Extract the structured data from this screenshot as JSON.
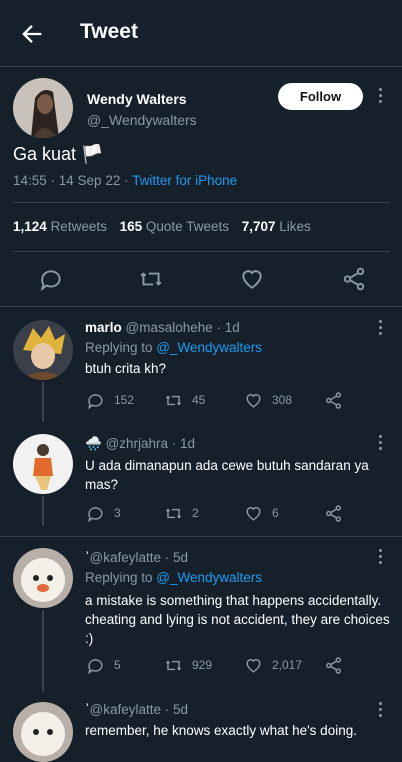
{
  "header": {
    "title": "Tweet",
    "back_icon": "back-arrow-icon"
  },
  "tweet": {
    "author_name": "Wendy Walters",
    "author_handle": "@_Wendywalters",
    "follow_label": "Follow",
    "text": "Ga kuat 🏳️",
    "time": "14:55 · 14 Sep 22 · ",
    "source": "Twitter for iPhone",
    "retweets_count": "1,124",
    "retweets_label": "Retweets",
    "quotes_count": "165",
    "quotes_label": "Quote Tweets",
    "likes_count": "7,707",
    "likes_label": "Likes"
  },
  "replies": [
    {
      "name": "marlo",
      "handle": "@masalohehe · 1d",
      "replying_prefix": "Replying to ",
      "replying_to": "@_Wendywalters",
      "text": "btuh crita kh?",
      "reply_count": "152",
      "retweet_count": "45",
      "like_count": "308"
    },
    {
      "name": "🌧️",
      "handle": "@zhrjahra · 1d",
      "text": "U ada dimanapun ada cewe butuh sandaran ya mas?",
      "reply_count": "3",
      "retweet_count": "2",
      "like_count": "6"
    },
    {
      "name": "ʾ",
      "handle": "@kafeylatte · 5d",
      "replying_prefix": "Replying to ",
      "replying_to": "@_Wendywalters",
      "text": "a mistake is something that happens accidentally. cheating and lying is not accident, they are choices :)",
      "reply_count": "5",
      "retweet_count": "929",
      "like_count": "2,017"
    },
    {
      "name": "ʾ",
      "handle": "@kafeylatte · 5d",
      "text": "remember, he knows exactly what he's doing."
    }
  ],
  "colors": {
    "background": "#15202b",
    "accent": "#1d9bf0",
    "muted": "#8b98a5",
    "divider": "#38444d"
  }
}
